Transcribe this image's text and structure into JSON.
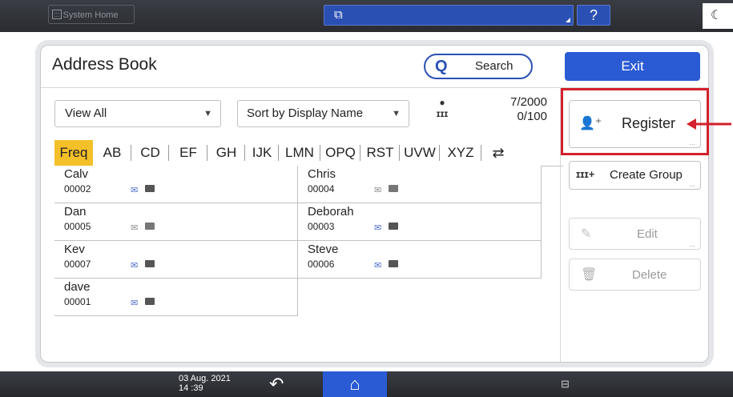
{
  "topbar": {
    "system_home": "System Home",
    "help": "?"
  },
  "header": {
    "title": "Address Book",
    "search": "Search",
    "exit": "Exit"
  },
  "filters": {
    "view": "View All",
    "sort": "Sort by Display Name"
  },
  "counts": {
    "users": "7/2000",
    "groups": "0/100"
  },
  "tabs": [
    "Freq",
    "AB",
    "CD",
    "EF",
    "GH",
    "IJK",
    "LMN",
    "OPQ",
    "RST",
    "UVW",
    "XYZ"
  ],
  "entries": [
    {
      "name": "Calv",
      "number": "00002",
      "mail_active": true
    },
    {
      "name": "Chris",
      "number": "00004",
      "mail_active": false
    },
    {
      "name": "Dan",
      "number": "00005",
      "mail_active": false
    },
    {
      "name": "Deborah",
      "number": "00003",
      "mail_active": true
    },
    {
      "name": "Kev",
      "number": "00007",
      "mail_active": true
    },
    {
      "name": "Steve",
      "number": "00006",
      "mail_active": true
    },
    {
      "name": "dave",
      "number": "00001",
      "mail_active": true
    }
  ],
  "side": {
    "register": "Register",
    "create_group": "Create Group",
    "edit": "Edit",
    "delete": "Delete"
  },
  "bottombar": {
    "date": "03 Aug. 2021",
    "time": "14 :39"
  },
  "colors": {
    "accent_blue": "#2a5ad4",
    "active_tab": "#f4c02a",
    "highlight_red": "#d3202c"
  }
}
